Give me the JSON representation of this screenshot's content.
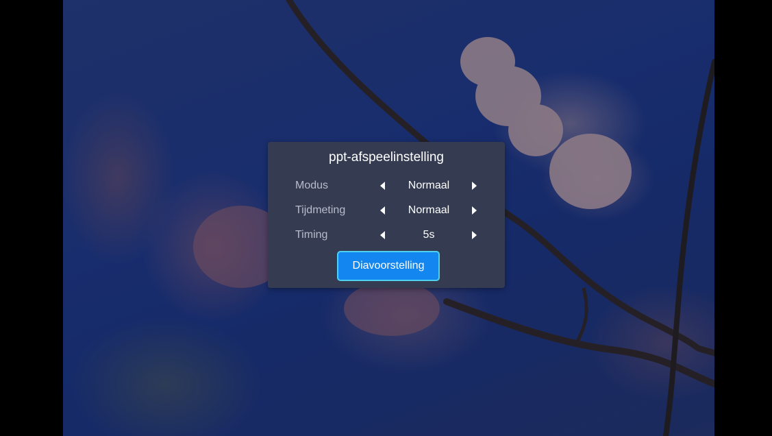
{
  "dialog": {
    "title": "ppt-afspeelinstelling",
    "rows": [
      {
        "label": "Modus",
        "value": "Normaal"
      },
      {
        "label": "Tijdmeting",
        "value": "Normaal"
      },
      {
        "label": "Timing",
        "value": "5s"
      }
    ],
    "start_button_label": "Diavoorstelling"
  },
  "icons": {
    "decrease": "caret-left-icon",
    "increase": "caret-right-icon"
  },
  "colors": {
    "dialog_background": "#353c52",
    "button_background": "#1486ef",
    "button_border": "#4fd2f0",
    "label_text": "#b9bccb",
    "value_text": "#ffffff"
  }
}
